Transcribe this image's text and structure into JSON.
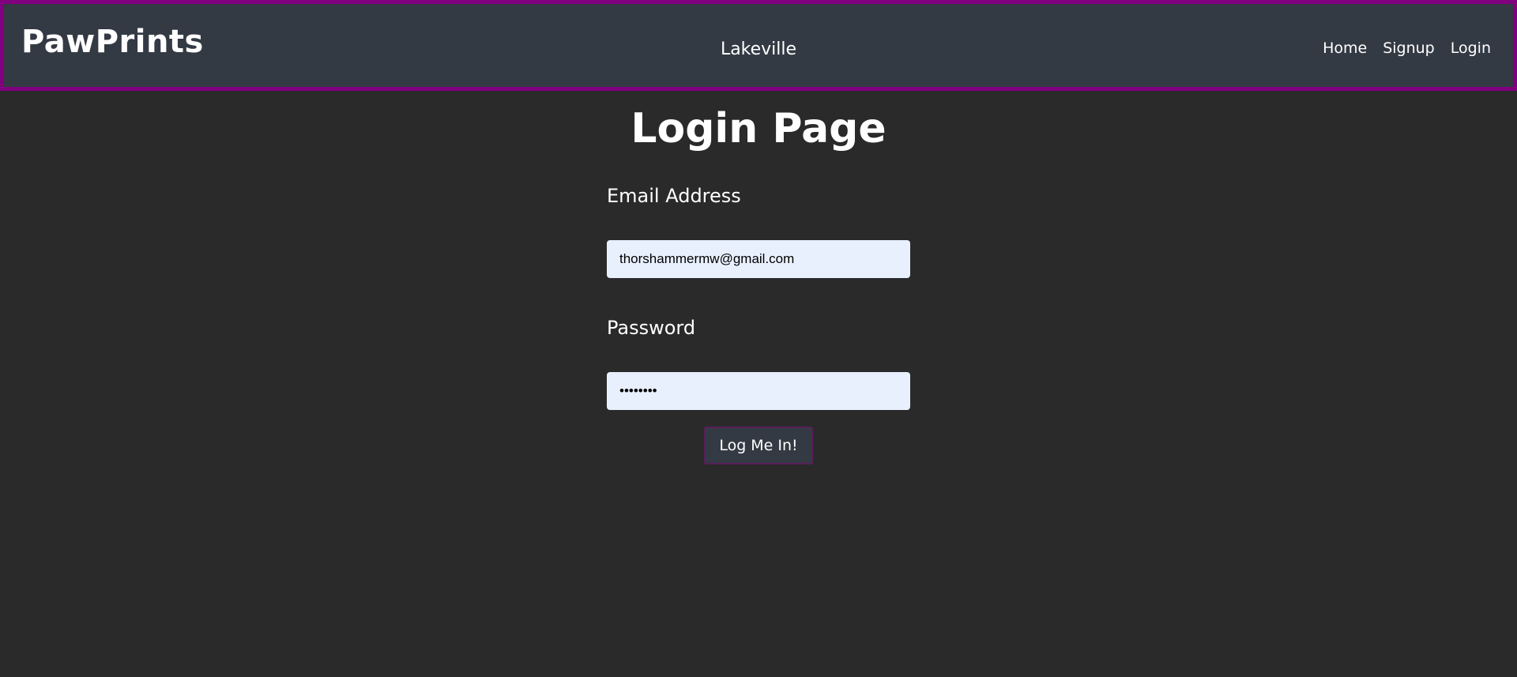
{
  "navbar": {
    "brand": "PawPrints",
    "location": "Lakeville",
    "links": [
      {
        "label": "Home"
      },
      {
        "label": "Signup"
      },
      {
        "label": "Login"
      }
    ],
    "border_color": "#800080",
    "background_color": "#343a44"
  },
  "page": {
    "title": "Login Page",
    "background_color": "#2a2a2a"
  },
  "form": {
    "email_label": "Email Address",
    "email_value": "thorshammermw@gmail.com",
    "password_label": "Password",
    "password_value": "••••••••",
    "submit_label": "Log Me In!",
    "input_background": "#e8f0fe"
  }
}
